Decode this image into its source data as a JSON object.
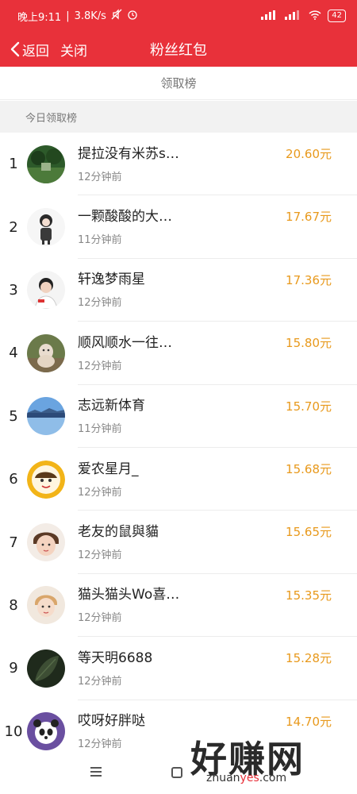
{
  "statusbar": {
    "time": "晚上9:11",
    "speed": "3.8K/s",
    "network": "HD",
    "battery": "42"
  },
  "navbar": {
    "back_label": "返回",
    "close_label": "关闭",
    "title": "粉丝红包"
  },
  "tab": {
    "label": "领取榜"
  },
  "section": {
    "title": "今日领取榜"
  },
  "list": [
    {
      "rank": "1",
      "name": "提拉没有米苏s…",
      "time": "12分钟前",
      "amount": "20.60元",
      "avatar": "landscape-green"
    },
    {
      "rank": "2",
      "name": "一颗酸酸的大…",
      "time": "11分钟前",
      "amount": "17.67元",
      "avatar": "anime-figure"
    },
    {
      "rank": "3",
      "name": "轩逸梦雨星",
      "time": "12分钟前",
      "amount": "17.36元",
      "avatar": "person-white"
    },
    {
      "rank": "4",
      "name": "顺风顺水一往…",
      "time": "12分钟前",
      "amount": "15.80元",
      "avatar": "dog"
    },
    {
      "rank": "5",
      "name": "志远新体育",
      "time": "11分钟前",
      "amount": "15.70元",
      "avatar": "lake-sky"
    },
    {
      "rank": "6",
      "name": "爱农星月_",
      "time": "12分钟前",
      "amount": "15.68元",
      "avatar": "cartoon-face"
    },
    {
      "rank": "7",
      "name": "老友的鼠與貓",
      "time": "12分钟前",
      "amount": "15.65元",
      "avatar": "child-face"
    },
    {
      "rank": "8",
      "name": "猫头猫头Wo喜…",
      "time": "12分钟前",
      "amount": "15.35元",
      "avatar": "boy-face"
    },
    {
      "rank": "9",
      "name": "等天明6688",
      "time": "12分钟前",
      "amount": "15.28元",
      "avatar": "dark-leaf"
    },
    {
      "rank": "10",
      "name": "哎呀好胖哒",
      "time": "12分钟前",
      "amount": "14.70元",
      "avatar": "panda"
    }
  ],
  "watermark": {
    "text": "好赚网",
    "url_prefix": "zhuan",
    "url_mid": "yes",
    "url_suffix": ".com"
  }
}
